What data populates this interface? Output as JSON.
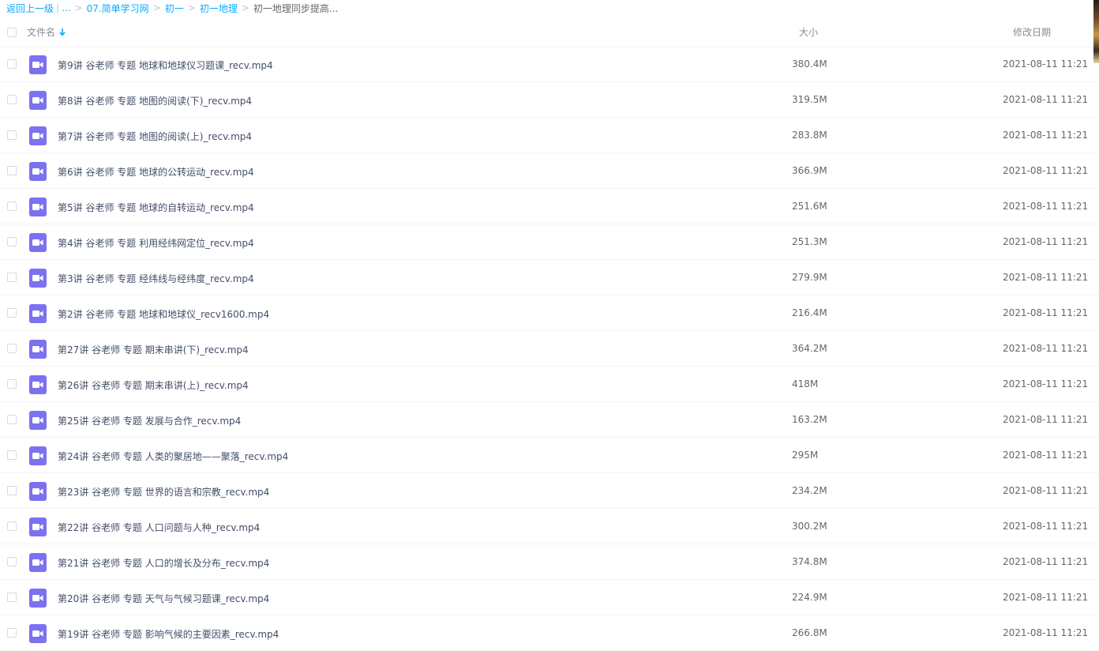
{
  "breadcrumb": {
    "back": "返回上一级",
    "bar": "|",
    "ellipsis": "...",
    "sep": ">",
    "items": [
      "07.简单学习网",
      "初一",
      "初一地理"
    ],
    "current": "初一地理同步提高..."
  },
  "header": {
    "name": "文件名",
    "size": "大小",
    "date": "修改日期"
  },
  "files": [
    {
      "name": "第9讲 谷老师 专题 地球和地球仪习题课_recv.mp4",
      "size": "380.4M",
      "date": "2021-08-11 11:21"
    },
    {
      "name": "第8讲 谷老师 专题 地图的阅读(下)_recv.mp4",
      "size": "319.5M",
      "date": "2021-08-11 11:21"
    },
    {
      "name": "第7讲 谷老师 专题 地图的阅读(上)_recv.mp4",
      "size": "283.8M",
      "date": "2021-08-11 11:21"
    },
    {
      "name": "第6讲 谷老师 专题 地球的公转运动_recv.mp4",
      "size": "366.9M",
      "date": "2021-08-11 11:21"
    },
    {
      "name": "第5讲 谷老师 专题 地球的自转运动_recv.mp4",
      "size": "251.6M",
      "date": "2021-08-11 11:21"
    },
    {
      "name": "第4讲 谷老师 专题 利用经纬网定位_recv.mp4",
      "size": "251.3M",
      "date": "2021-08-11 11:21"
    },
    {
      "name": "第3讲 谷老师 专题 经纬线与经纬度_recv.mp4",
      "size": "279.9M",
      "date": "2021-08-11 11:21"
    },
    {
      "name": "第2讲 谷老师 专题 地球和地球仪_recv1600.mp4",
      "size": "216.4M",
      "date": "2021-08-11 11:21"
    },
    {
      "name": "第27讲 谷老师 专题 期末串讲(下)_recv.mp4",
      "size": "364.2M",
      "date": "2021-08-11 11:21"
    },
    {
      "name": "第26讲 谷老师 专题 期末串讲(上)_recv.mp4",
      "size": "418M",
      "date": "2021-08-11 11:21"
    },
    {
      "name": "第25讲 谷老师 专题 发展与合作_recv.mp4",
      "size": "163.2M",
      "date": "2021-08-11 11:21"
    },
    {
      "name": "第24讲 谷老师 专题 人类的聚居地——聚落_recv.mp4",
      "size": "295M",
      "date": "2021-08-11 11:21"
    },
    {
      "name": "第23讲 谷老师 专题 世界的语言和宗教_recv.mp4",
      "size": "234.2M",
      "date": "2021-08-11 11:21"
    },
    {
      "name": "第22讲 谷老师 专题 人口问题与人种_recv.mp4",
      "size": "300.2M",
      "date": "2021-08-11 11:21"
    },
    {
      "name": "第21讲 谷老师 专题 人口的增长及分布_recv.mp4",
      "size": "374.8M",
      "date": "2021-08-11 11:21"
    },
    {
      "name": "第20讲 谷老师 专题 天气与气候习题课_recv.mp4",
      "size": "224.9M",
      "date": "2021-08-11 11:21"
    },
    {
      "name": "第19讲 谷老师 专题 影响气候的主要因素_recv.mp4",
      "size": "266.8M",
      "date": "2021-08-11 11:21"
    }
  ],
  "icons": {
    "file": "video-file-icon",
    "sort": "sort-down-arrow-icon"
  },
  "colors": {
    "link": "#09aaff",
    "video_icon": "#7c71f0"
  }
}
